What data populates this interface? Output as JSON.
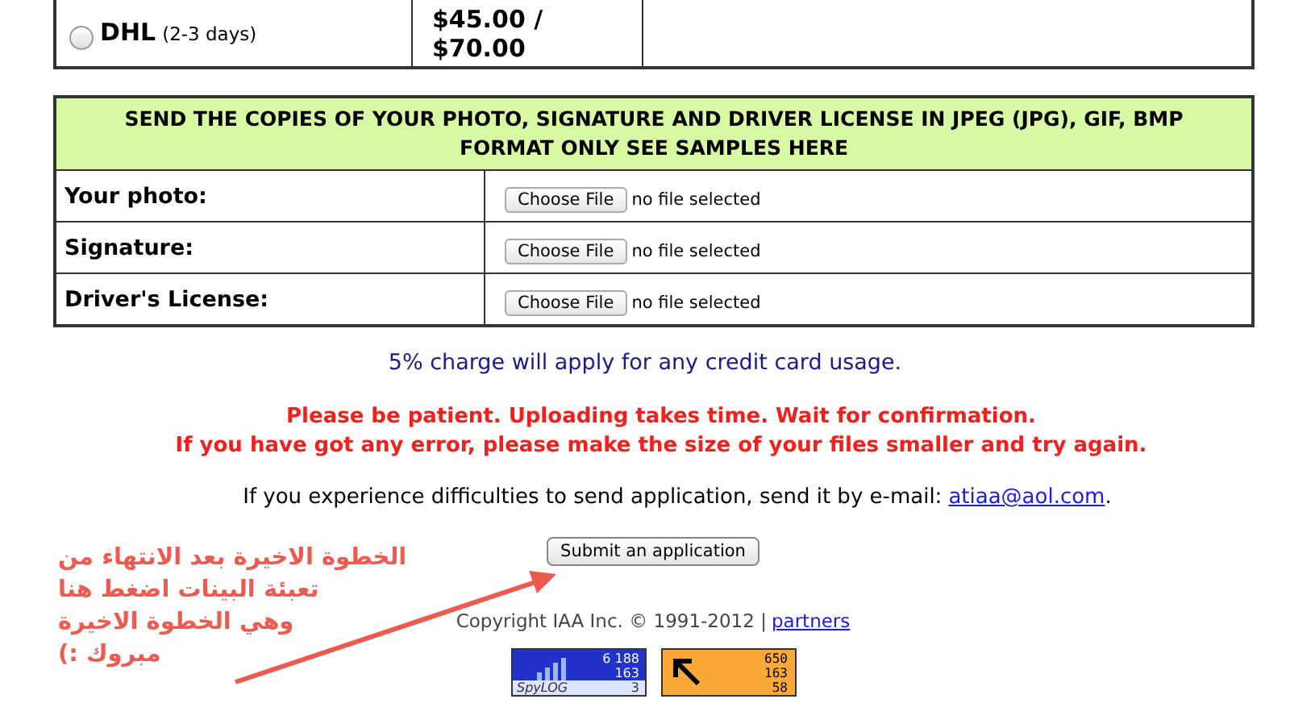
{
  "shipping_option": {
    "name": "DHL",
    "duration": "(2-3 days)",
    "price_lines": [
      "$45.00 /",
      "$70.00"
    ],
    "selected": false
  },
  "upload_section": {
    "header": "SEND THE COPIES OF YOUR PHOTO, SIGNATURE AND DRIVER LICENSE IN JPEG (JPG), GIF, BMP FORMAT ONLY SEE SAMPLES HERE",
    "rows": [
      {
        "label": "Your photo:",
        "button": "Choose File",
        "status": "no file selected"
      },
      {
        "label": "Signature:",
        "button": "Choose File",
        "status": "no file selected"
      },
      {
        "label": "Driver's License:",
        "button": "Choose File",
        "status": "no file selected"
      }
    ]
  },
  "charge_note": "5% charge will apply for any credit card usage.",
  "warning_lines": [
    "Please be patient. Uploading takes time. Wait for confirmation.",
    "If you have got any error, please make the size of your files smaller and try again."
  ],
  "contact": {
    "text": "If you experience difficulties to send application, send it by e-mail:",
    "email": "atiaa@aol.com",
    "trailing": "."
  },
  "submit_button": "Submit an application",
  "annotation_lines": [
    "الخطوة الاخيرة بعد الانتهاء من",
    "تعبئة البينات اضغط هنا",
    "وهي الخطوة الاخيرة",
    "مبروك :)"
  ],
  "footer": {
    "copyright": "Copyright IAA Inc. © 1991-2012 |",
    "link": "partners"
  },
  "counters": [
    {
      "kind": "bars",
      "logo": "SpyLOG",
      "values": [
        "6 188",
        "163",
        "3"
      ]
    },
    {
      "kind": "arrow",
      "values": [
        "650",
        "163",
        "58"
      ]
    }
  ]
}
